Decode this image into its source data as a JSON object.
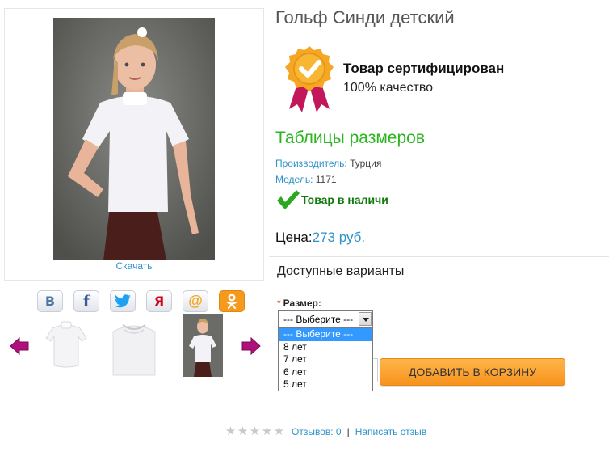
{
  "product": {
    "title": "Гольф Синди детский",
    "download_label": "Скачать"
  },
  "certificate": {
    "title": "Товар сертифицирован",
    "subtitle": "100% качество",
    "badge_icon": "certified-medal-icon"
  },
  "size_tables_link": "Таблицы размеров",
  "meta": {
    "manufacturer_label": "Производитель:",
    "manufacturer_value": "Турция",
    "model_label": "Модель:",
    "model_value": "1171"
  },
  "stock": {
    "text": "Товар в наличи",
    "icon": "checkmark-icon"
  },
  "price": {
    "label": "Цена:",
    "value": "273 руб."
  },
  "variants": {
    "heading": "Доступные варианты",
    "size_label": "Размер:",
    "required_mark": "*",
    "selected_value": "--- Выберите ---",
    "options": [
      "--- Выберите ---",
      "8 лет",
      "7 лет",
      "6 лет",
      "5 лет"
    ]
  },
  "cart_button": "ДОБАВИТЬ В КОРЗИНУ",
  "social": [
    {
      "name": "vk-icon",
      "glyph": "В",
      "color": "#4a76a8"
    },
    {
      "name": "facebook-icon",
      "glyph": "f",
      "color": "#3b5998"
    },
    {
      "name": "twitter-icon",
      "glyph": "🐦",
      "color": "#1da1f2"
    },
    {
      "name": "yandex-icon",
      "glyph": "Я",
      "color": "#d0021b"
    },
    {
      "name": "mailru-icon",
      "glyph": "@",
      "color": "#f5a623"
    },
    {
      "name": "odnoklassniki-icon",
      "glyph": "ОК",
      "color": "#ffffff"
    }
  ],
  "reviews": {
    "rating": 0,
    "max_rating": 5,
    "reviews_label": "Отзывов: 0",
    "separator": "|",
    "write_label": "Написать отзыв"
  },
  "colors": {
    "accent_blue": "#2e92c8",
    "green": "#2ab520",
    "button_orange": "#f7931e",
    "nav_arrow": "#b0107a"
  }
}
